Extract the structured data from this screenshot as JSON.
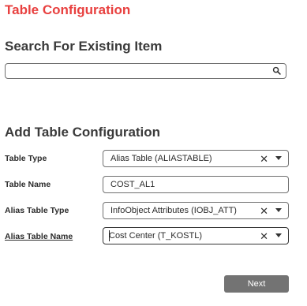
{
  "page": {
    "title": "Table Configuration"
  },
  "search": {
    "heading": "Search For Existing Item",
    "value": "",
    "placeholder": "",
    "icon": "search-icon"
  },
  "config": {
    "heading": "Add Table Configuration",
    "fields": [
      {
        "label": "Table Type",
        "value": "Alias Table (ALIASTABLE)",
        "type": "select",
        "clearable": true
      },
      {
        "label": "Table Name",
        "value": "COST_AL1",
        "type": "text"
      },
      {
        "label": "Alias Table Type",
        "value": "InfoObject Attributes (IOBJ_ATT)",
        "type": "select",
        "clearable": true
      },
      {
        "label": "Alias Table Name",
        "value": "Cost Center (T_KOSTL)",
        "type": "select",
        "clearable": true,
        "focused": true
      }
    ],
    "clear_glyph": "✕",
    "next_label": "Next"
  },
  "colors": {
    "title": "#e8403f",
    "button": "#737373"
  }
}
